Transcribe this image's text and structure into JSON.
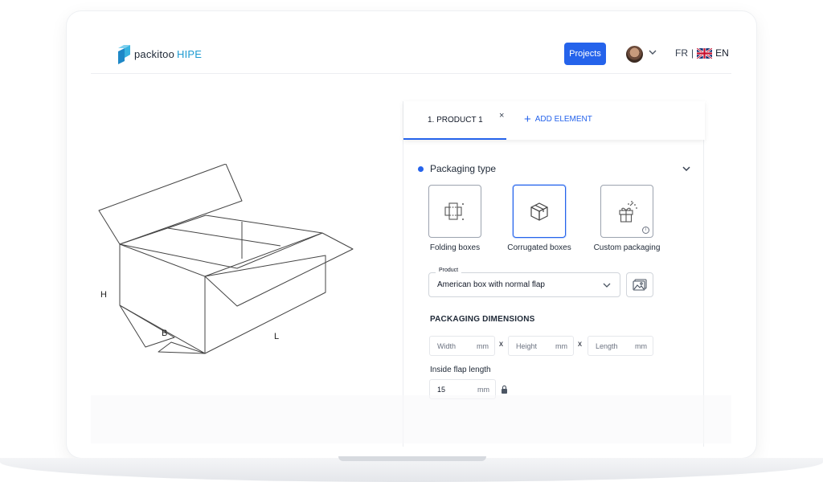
{
  "header": {
    "logo_name": "packitoo",
    "logo_suffix": "HIPE",
    "projects_label": "Projects",
    "lang_fr": "FR",
    "lang_sep": "|",
    "lang_en": "EN"
  },
  "drawing": {
    "label_h": "H",
    "label_b": "B",
    "label_l": "L"
  },
  "tabs": [
    {
      "label": "1. PRODUCT 1",
      "close": "×",
      "active": true
    },
    {
      "label": "ADD ELEMENT",
      "icon": "plus-icon"
    }
  ],
  "packaging": {
    "title": "Packaging type",
    "types": [
      {
        "label": "Folding boxes",
        "icon": "folding-box-icon",
        "selected": false
      },
      {
        "label": "Corrugated boxes",
        "icon": "corrugated-box-icon",
        "selected": true
      },
      {
        "label": "Custom packaging",
        "icon": "gift-box-icon",
        "selected": false
      }
    ],
    "product_legend": "Product",
    "product_value": "American box with normal flap"
  },
  "dimensions": {
    "title": "PACKAGING DIMENSIONS",
    "width_placeholder": "Width",
    "height_placeholder": "Height",
    "length_placeholder": "Length",
    "unit": "mm",
    "separator": "x",
    "flap_title": "Inside flap length",
    "flap_value": "15"
  },
  "colors": {
    "accent": "#2563eb",
    "logo_accent": "#1d9bd1"
  }
}
